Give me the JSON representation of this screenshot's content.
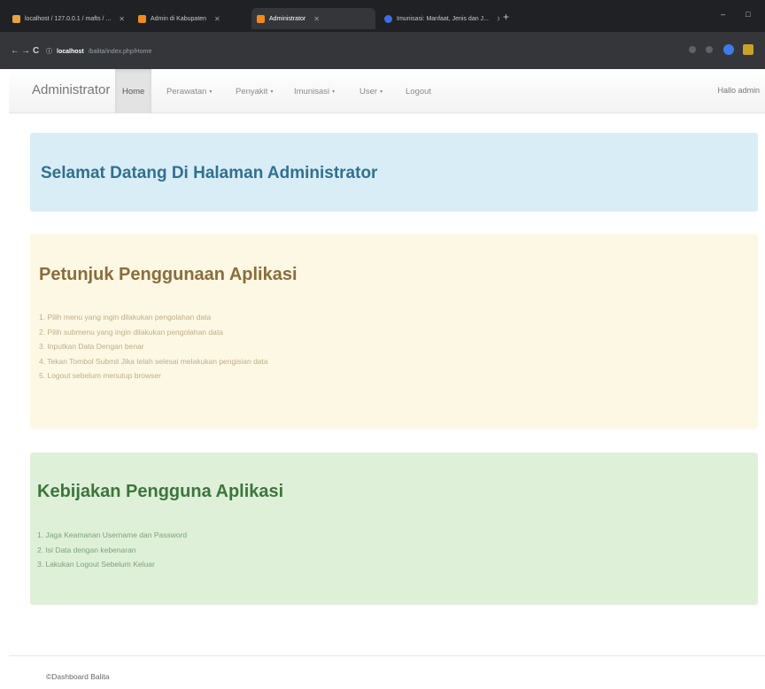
{
  "browser": {
    "tabs": [
      {
        "title": "localhost / 127.0.0.1 / mafts / ...",
        "favicon_color": "#e8a33d",
        "active": false
      },
      {
        "title": "Admin di Kabupaten",
        "favicon_color": "#f28a1c",
        "active": false
      },
      {
        "title": "Administrator",
        "favicon_color": "#f28a1c",
        "active": true
      },
      {
        "title": "Imunisasi: Manfaat, Jenis dan J...",
        "favicon_color": "#3d6ee8",
        "active": false
      }
    ],
    "new_tab": "+",
    "controls": {
      "minimize": "–",
      "maximize": "□"
    },
    "url": {
      "host": "localhost",
      "path": "/balita/index.php/Home"
    },
    "nav_icons": {
      "back": "←",
      "forward": "→",
      "reload": "C",
      "info": "ⓘ"
    }
  },
  "navbar": {
    "brand": "Administrator",
    "items": [
      {
        "label": "Home",
        "active": true,
        "dropdown": false
      },
      {
        "label": "Perawatan",
        "active": false,
        "dropdown": true
      },
      {
        "label": "Penyakit",
        "active": false,
        "dropdown": true
      },
      {
        "label": "Imunisasi",
        "active": false,
        "dropdown": true
      },
      {
        "label": "User",
        "active": false,
        "dropdown": true
      },
      {
        "label": "Logout",
        "active": false,
        "dropdown": false
      }
    ],
    "caret": "▾",
    "greeting": "Hallo admin"
  },
  "welcome": {
    "title": "Selamat Datang Di Halaman Administrator"
  },
  "guide": {
    "title": "Petunjuk Penggunaan Aplikasi",
    "steps": [
      "1. Pilih menu yang ingin dilakukan pengolahan data",
      "2. Pilih submenu yang ingin dilakukan pengolahan data",
      "3. Inputkan Data Dengan benar",
      "4. Tekan Tombol Submit Jika telah selesai melakukan pengisian data",
      "5. Logout sebelum menutup browser"
    ]
  },
  "policy": {
    "title": "Kebijakan Pengguna Aplikasi",
    "items": [
      "1. Jaga Keamanan Username dan Password",
      "2. Isi Data dengan kebenaran",
      "3. Lakukan Logout Sebelum Keluar"
    ]
  },
  "footer": {
    "text": "©Dashboard Balita"
  },
  "colors": {
    "info_bg": "#d9edf7",
    "info_text": "#31708f",
    "warning_bg": "#fcf8e3",
    "warning_text": "#8a6d3b",
    "success_bg": "#dff0d8",
    "success_text": "#3c763d"
  }
}
